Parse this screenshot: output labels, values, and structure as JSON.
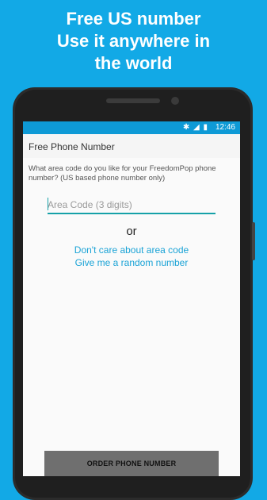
{
  "promo": {
    "line1": "Free US number",
    "line2": "Use it anywhere in",
    "line3": "the world"
  },
  "status_bar": {
    "icons_text": "✱ ◢ ▮",
    "icon_names": [
      "bluetooth-icon",
      "signal-icon",
      "battery-icon"
    ],
    "time": "12:46"
  },
  "app": {
    "title": "Free Phone Number",
    "prompt": "What area code do you like for your FreedomPop phone number? (US based phone number only)",
    "area_code": {
      "value": "",
      "placeholder": "Area Code (3 digits)"
    },
    "or_text": "or",
    "link_no_area": "Don't care about area code",
    "link_random": "Give me a random number",
    "order_button": "ORDER PHONE NUMBER"
  },
  "colors": {
    "background": "#12a9e6",
    "status_bar": "#0e9ad6",
    "accent_link": "#1aa3d6",
    "input_underline": "#16a1a8",
    "button": "#6f6f6f"
  }
}
